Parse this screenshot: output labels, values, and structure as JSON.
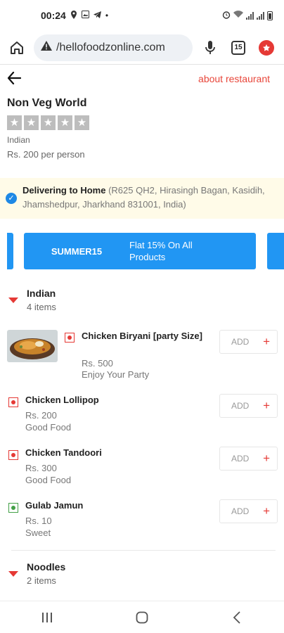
{
  "status_bar": {
    "time": "00:24"
  },
  "browser": {
    "url": "/hellofoodzonline.com",
    "tab_count": "15"
  },
  "restaurant": {
    "about_label": "about restaurant",
    "name": "Non Veg World",
    "cuisine": "Indian",
    "price": "Rs. 200 per person",
    "rating_stars": 0
  },
  "delivery": {
    "title": "Delivering to Home",
    "address": "(R625 QH2, Hirasingh Bagan, Kasidih, Jhamshedpur, Jharkhand 831001, India)"
  },
  "promo": {
    "code": "SUMMER15",
    "description": "Flat 15% On All Products"
  },
  "categories": [
    {
      "title": "Indian",
      "count": "4 items"
    },
    {
      "title": "Noodles",
      "count": "2 items"
    }
  ],
  "items": [
    {
      "name": "Chicken Biryani [party Size]",
      "price": "Rs. 500",
      "desc": "Enjoy Your Party",
      "veg": false,
      "add_label": "ADD"
    },
    {
      "name": "Chicken Lollipop",
      "price": "Rs. 200",
      "desc": "Good Food",
      "veg": false,
      "add_label": "ADD"
    },
    {
      "name": "Chicken Tandoori",
      "price": "Rs. 300",
      "desc": "Good Food",
      "veg": false,
      "add_label": "ADD"
    },
    {
      "name": "Gulab Jamun",
      "price": "Rs. 10",
      "desc": "Sweet",
      "veg": true,
      "add_label": "ADD"
    }
  ],
  "colors": {
    "accent": "#e8463a",
    "promo_blue": "#2196f3",
    "delivery_bg": "#fffbe8",
    "veg_green": "#43a047"
  }
}
